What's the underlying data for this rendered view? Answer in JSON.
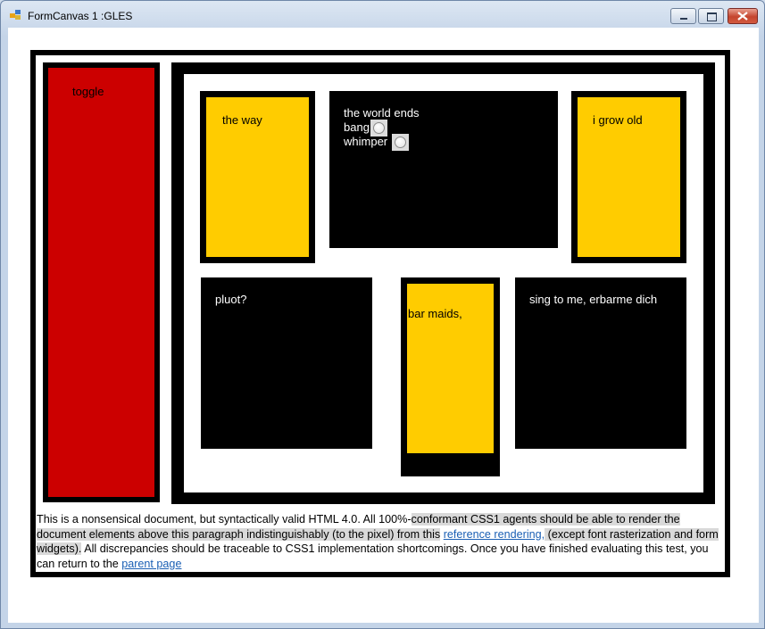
{
  "window": {
    "title": "FormCanvas 1 :GLES"
  },
  "boxes": {
    "toggle": "toggle",
    "the_way": "the way",
    "world_ends": "the world ends",
    "bang": "bang",
    "whimper": "whimper",
    "grow_old": "i grow old",
    "pluot": "pluot?",
    "bar_maids": "bar maids,",
    "sing": "sing to me, erbarme dich"
  },
  "paragraph": {
    "text1": "This is a nonsensical document, but syntactically valid HTML 4.0. All 100%-",
    "text2": "conformant CSS1 agents should be able to render the document elements above this paragraph indistinguishably (to the pixel) from this",
    "link1": "reference rendering,",
    "text3": " (except font rasterization and form widgets).",
    "text4": " All discrepancies should be traceable to CSS1 implementation shortcomings. Once you have finished evaluating this test, you can return to the ",
    "link2": "parent page"
  },
  "colors": {
    "red": "#cc0000",
    "yellow": "#ffcc00",
    "black": "#000000",
    "link": "#1a5fb4"
  }
}
